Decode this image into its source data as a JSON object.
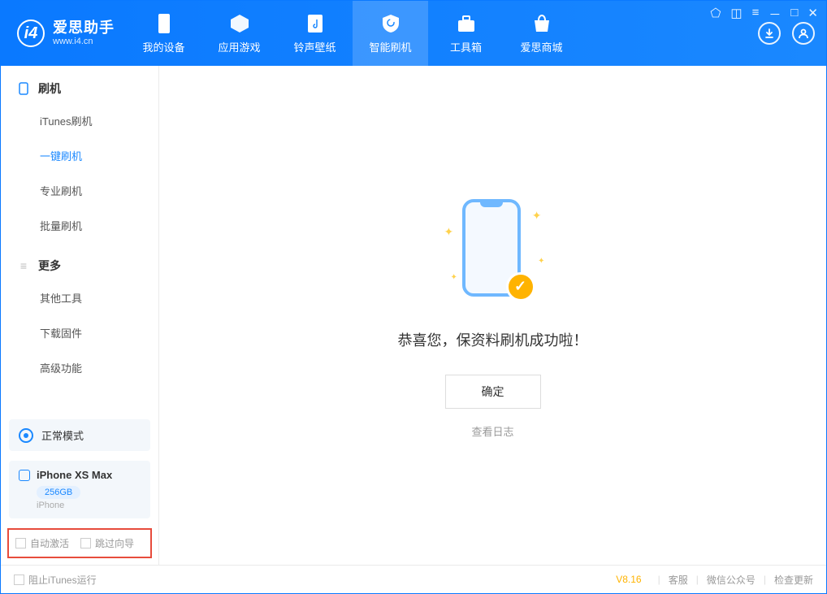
{
  "app": {
    "title": "爱思助手",
    "subtitle": "www.i4.cn"
  },
  "header_tabs": [
    {
      "label": "我的设备"
    },
    {
      "label": "应用游戏"
    },
    {
      "label": "铃声壁纸"
    },
    {
      "label": "智能刷机"
    },
    {
      "label": "工具箱"
    },
    {
      "label": "爱思商城"
    }
  ],
  "sidebar": {
    "section1": {
      "title": "刷机",
      "items": [
        "iTunes刷机",
        "一键刷机",
        "专业刷机",
        "批量刷机"
      ],
      "active_index": 1
    },
    "section2": {
      "title": "更多",
      "items": [
        "其他工具",
        "下载固件",
        "高级功能"
      ]
    }
  },
  "device": {
    "mode": "正常模式",
    "name": "iPhone XS Max",
    "storage": "256GB",
    "type": "iPhone"
  },
  "options": {
    "auto_activate": "自动激活",
    "skip_guide": "跳过向导"
  },
  "main": {
    "success_message": "恭喜您，保资料刷机成功啦！",
    "ok_button": "确定",
    "view_log": "查看日志"
  },
  "footer": {
    "block_itunes": "阻止iTunes运行",
    "version": "V8.16",
    "links": [
      "客服",
      "微信公众号",
      "检查更新"
    ]
  }
}
